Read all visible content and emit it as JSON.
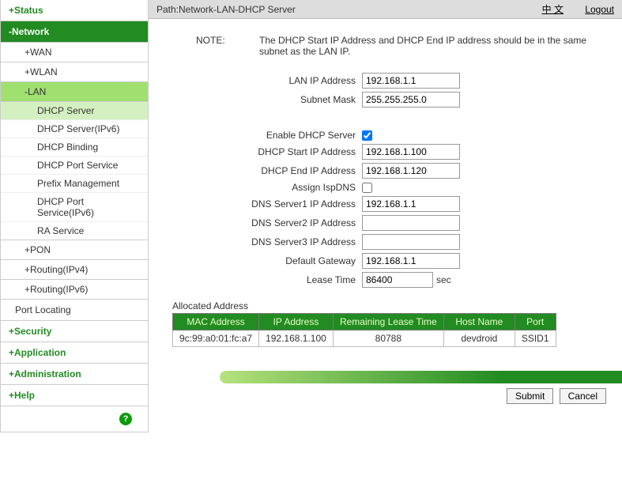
{
  "topbar": {
    "path": "Path:Network-LAN-DHCP Server",
    "zhongwen": "中 文",
    "logout": "Logout"
  },
  "nav": {
    "status": "+Status",
    "network": "-Network",
    "wan": "+WAN",
    "wlan": "+WLAN",
    "lan": "-LAN",
    "dhcp_server": "DHCP Server",
    "dhcp_server_ipv6": "DHCP Server(IPv6)",
    "dhcp_binding": "DHCP Binding",
    "dhcp_port_service": "DHCP Port Service",
    "prefix_management": "Prefix Management",
    "dhcp_port_service_ipv6": "DHCP Port Service(IPv6)",
    "ra_service": "RA Service",
    "pon": "+PON",
    "routing_ipv4": "+Routing(IPv4)",
    "routing_ipv6": "+Routing(IPv6)",
    "port_locating": "Port Locating",
    "security": "+Security",
    "application": "+Application",
    "administration": "+Administration",
    "help": "+Help"
  },
  "note": {
    "label": "NOTE:",
    "text": "The DHCP Start IP Address and DHCP End IP address should be in the same subnet as the LAN IP."
  },
  "form": {
    "lan_ip_label": "LAN IP Address",
    "lan_ip_value": "192.168.1.1",
    "subnet_label": "Subnet Mask",
    "subnet_value": "255.255.255.0",
    "enable_label": "Enable DHCP Server",
    "start_ip_label": "DHCP Start IP Address",
    "start_ip_value": "192.168.1.100",
    "end_ip_label": "DHCP End IP Address",
    "end_ip_value": "192.168.1.120",
    "assign_label": "Assign IspDNS",
    "dns1_label": "DNS Server1 IP Address",
    "dns1_value": "192.168.1.1",
    "dns2_label": "DNS Server2 IP Address",
    "dns2_value": "",
    "dns3_label": "DNS Server3 IP Address",
    "dns3_value": "",
    "gateway_label": "Default Gateway",
    "gateway_value": "192.168.1.1",
    "lease_label": "Lease Time",
    "lease_value": "86400",
    "lease_suffix": "sec"
  },
  "alloc": {
    "title": "Allocated Address",
    "headers": {
      "mac": "MAC Address",
      "ip": "IP Address",
      "remaining": "Remaining Lease Time",
      "host": "Host Name",
      "port": "Port"
    },
    "rows": [
      {
        "mac": "9c:99:a0:01:fc:a7",
        "ip": "192.168.1.100",
        "remaining": "80788",
        "host": "devdroid",
        "port": "SSID1"
      }
    ]
  },
  "buttons": {
    "submit": "Submit",
    "cancel": "Cancel"
  }
}
